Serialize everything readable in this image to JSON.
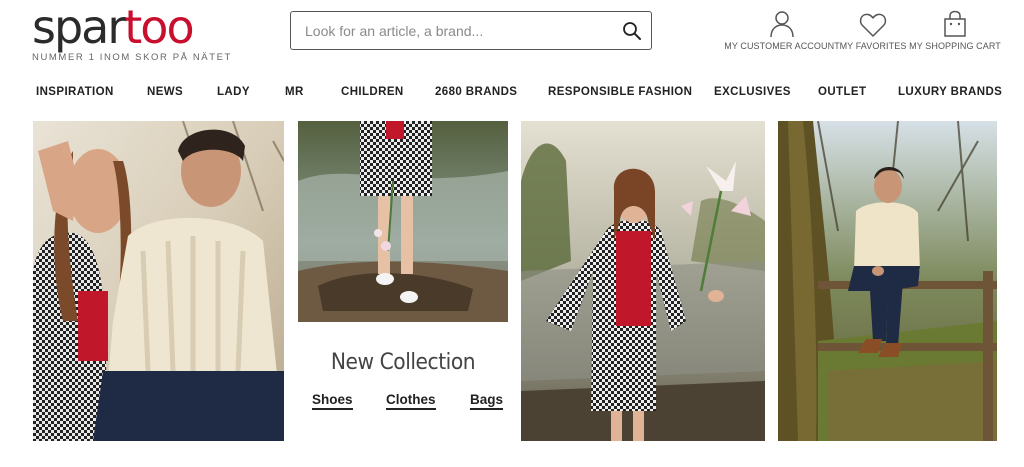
{
  "header": {
    "logo": {
      "part1": "spar",
      "part2": "too",
      "tagline": "NUMMER 1 INOM SKOR PÅ NÄTET"
    },
    "search": {
      "placeholder": "Look for an article, a brand..."
    },
    "account_links": {
      "customer_account": "MY CUSTOMER ACCOUNT",
      "favorites": "MY FAVORITES",
      "shopping_cart": "MY SHOPPING CART"
    }
  },
  "nav": {
    "items": [
      "INSPIRATION",
      "NEWS",
      "LADY",
      "MR",
      "CHILDREN",
      "2680 BRANDS",
      "RESPONSIBLE FASHION",
      "EXCLUSIVES",
      "OUTLET",
      "LUXURY BRANDS"
    ]
  },
  "banner": {
    "collection_title": "New Collection",
    "links": [
      "Shoes",
      "Clothes",
      "Bags"
    ]
  },
  "colors": {
    "brand_red": "#c8102e",
    "text_dark": "#222222"
  },
  "icons": [
    "person-icon",
    "heart-icon",
    "shopping-bag-icon",
    "search-icon"
  ]
}
